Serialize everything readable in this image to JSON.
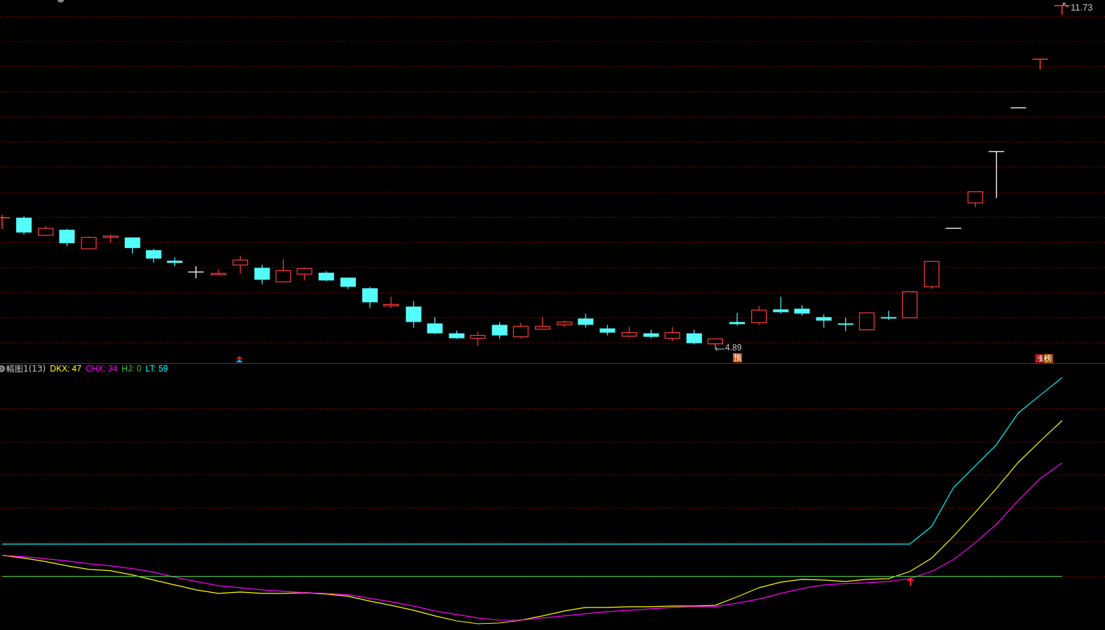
{
  "main_panel": {
    "high_label": "11.73",
    "low_label": "4.89",
    "badges": [
      {
        "text": "预",
        "kind": "forecast"
      },
      {
        "text": "涨榜",
        "kind": "limit-up"
      }
    ]
  },
  "sub_panel": {
    "title": "幅图1(13)",
    "indicators": [
      {
        "label": "DKX: 47",
        "color": "#ffff00"
      },
      {
        "label": "CHX: 34",
        "color": "#ff00ff"
      },
      {
        "label": "HJ: 0",
        "color": "#44c044"
      },
      {
        "label": "LT: 59",
        "color": "#00ffff"
      }
    ]
  }
}
